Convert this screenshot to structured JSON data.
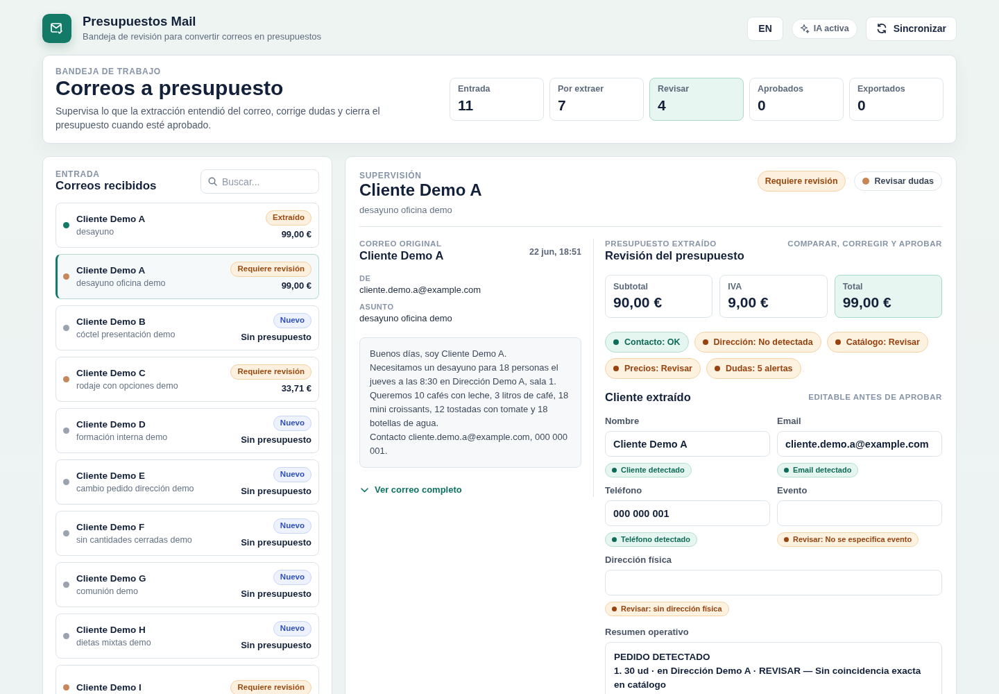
{
  "app": {
    "title": "Presupuestos Mail",
    "subtitle": "Bandeja de revisión para convertir correos en presupuestos"
  },
  "toolbar": {
    "language": "EN",
    "ai_status": "IA activa",
    "sync": "Sincronizar"
  },
  "workspace": {
    "eyebrow": "BANDEJA DE TRABAJO",
    "title": "Correos a presupuesto",
    "description": "Supervisa lo que la extracción entendió del correo, corrige dudas y cierra el presupuesto cuando esté aprobado.",
    "stats": [
      {
        "label": "Entrada",
        "value": "11",
        "selected": false
      },
      {
        "label": "Por extraer",
        "value": "7",
        "selected": false
      },
      {
        "label": "Revisar",
        "value": "4",
        "selected": true
      },
      {
        "label": "Aprobados",
        "value": "0",
        "selected": false
      },
      {
        "label": "Exportados",
        "value": "0",
        "selected": false
      }
    ]
  },
  "inbox": {
    "eyebrow": "ENTRADA",
    "title": "Correos recibidos",
    "search": {
      "placeholder": "Buscar..."
    },
    "emails": [
      {
        "client": "Cliente Demo A",
        "subject": "desayuno",
        "badge": {
          "text": "Extraído",
          "kind": "warning"
        },
        "amount": "99,00 €",
        "color": "#127a66",
        "selected": false
      },
      {
        "client": "Cliente Demo A",
        "subject": "desayuno oficina demo",
        "badge": {
          "text": "Requiere revisión",
          "kind": "warning"
        },
        "amount": "99,00 €",
        "color": "#c8875a",
        "selected": true
      },
      {
        "client": "Cliente Demo B",
        "subject": "cóctel presentación demo",
        "badge": {
          "text": "Nuevo",
          "kind": "info"
        },
        "amount": "Sin presupuesto",
        "color": "#9aa3af",
        "selected": false
      },
      {
        "client": "Cliente Demo C",
        "subject": "rodaje con opciones demo",
        "badge": {
          "text": "Requiere revisión",
          "kind": "warning"
        },
        "amount": "33,71 €",
        "color": "#c8875a",
        "selected": false
      },
      {
        "client": "Cliente Demo D",
        "subject": "formación interna demo",
        "badge": {
          "text": "Nuevo",
          "kind": "info"
        },
        "amount": "Sin presupuesto",
        "color": "#9aa3af",
        "selected": false
      },
      {
        "client": "Cliente Demo E",
        "subject": "cambio pedido dirección demo",
        "badge": {
          "text": "Nuevo",
          "kind": "info"
        },
        "amount": "Sin presupuesto",
        "color": "#9aa3af",
        "selected": false
      },
      {
        "client": "Cliente Demo F",
        "subject": "sin cantidades cerradas demo",
        "badge": {
          "text": "Nuevo",
          "kind": "info"
        },
        "amount": "Sin presupuesto",
        "color": "#9aa3af",
        "selected": false
      },
      {
        "client": "Cliente Demo G",
        "subject": "comunión demo",
        "badge": {
          "text": "Nuevo",
          "kind": "info"
        },
        "amount": "Sin presupuesto",
        "color": "#9aa3af",
        "selected": false
      },
      {
        "client": "Cliente Demo H",
        "subject": "dietas mixtas demo",
        "badge": {
          "text": "Nuevo",
          "kind": "info"
        },
        "amount": "Sin presupuesto",
        "color": "#9aa3af",
        "selected": false
      },
      {
        "client": "Cliente Demo I",
        "badge": {
          "text": "Requiere revisión",
          "kind": "warning"
        },
        "color": "#c8875a",
        "selected": false
      }
    ]
  },
  "supervision": {
    "eyebrow": "SUPERVISIÓN",
    "title": "Cliente Demo A",
    "subtitle": "desayuno oficina demo",
    "badge": {
      "text": "Requiere revisión",
      "kind": "warning"
    },
    "action": "Revisar dudas"
  },
  "original_email": {
    "eyebrow": "CORREO ORIGINAL",
    "title": "Cliente Demo A",
    "date": "22 jun, 18:51",
    "fields": [
      {
        "label": "DE",
        "value": "cliente.demo.a@example.com"
      },
      {
        "label": "ASUNTO",
        "value": "desayuno oficina demo"
      }
    ],
    "body": "Buenos días, soy Cliente Demo A.\nNecesitamos un desayuno para 18 personas el jueves a las 8:30 en Dirección Demo A, sala 1. Queremos 10 cafés con leche, 3 litros de café, 18 mini croissants, 12 tostadas con tomate y 18 botellas de agua.\nContacto cliente.demo.a@example.com, 000 000 001.",
    "expand_link": "Ver correo completo"
  },
  "budget": {
    "eyebrow": "PRESUPUESTO EXTRAÍDO",
    "title": "Revisión del presupuesto",
    "hint": "COMPARAR, CORREGIR Y APROBAR",
    "totals": [
      {
        "label": "Subtotal",
        "value": "90,00 €",
        "highlighted": false
      },
      {
        "label": "IVA",
        "value": "9,00 €",
        "highlighted": false
      },
      {
        "label": "Total",
        "value": "99,00 €",
        "highlighted": true
      }
    ],
    "checks": [
      {
        "text": "Contacto: OK",
        "kind": "ok"
      },
      {
        "text": "Dirección: No detectada",
        "kind": "warning"
      },
      {
        "text": "Catálogo: Revisar",
        "kind": "warning"
      },
      {
        "text": "Precios: Revisar",
        "kind": "warning"
      },
      {
        "text": "Dudas: 5 alertas",
        "kind": "warning"
      }
    ]
  },
  "client": {
    "title": "Cliente extraído",
    "hint": "EDITABLE ANTES DE APROBAR",
    "fields": [
      {
        "label": "Nombre",
        "value": "Cliente Demo A",
        "wide": false,
        "check": {
          "text": "Cliente detectado",
          "kind": "ok"
        }
      },
      {
        "label": "Email",
        "value": "cliente.demo.a@example.com",
        "wide": false,
        "check": {
          "text": "Email detectado",
          "kind": "ok"
        }
      },
      {
        "label": "Teléfono",
        "value": "000 000 001",
        "wide": false,
        "check": {
          "text": "Teléfono detectado",
          "kind": "ok"
        }
      },
      {
        "label": "Evento",
        "wide": false,
        "check": {
          "text": "Revisar: No se especifica evento",
          "kind": "warning"
        }
      },
      {
        "label": "Dirección física",
        "wide": true,
        "check": {
          "text": "Revisar: sin dirección física",
          "kind": "warning"
        }
      }
    ]
  },
  "summary": {
    "label": "Resumen operativo",
    "value": "PEDIDO DETECTADO\n1. 30 ud · en Dirección Demo A · REVISAR — Sin coincidencia exacta en catálogo"
  }
}
